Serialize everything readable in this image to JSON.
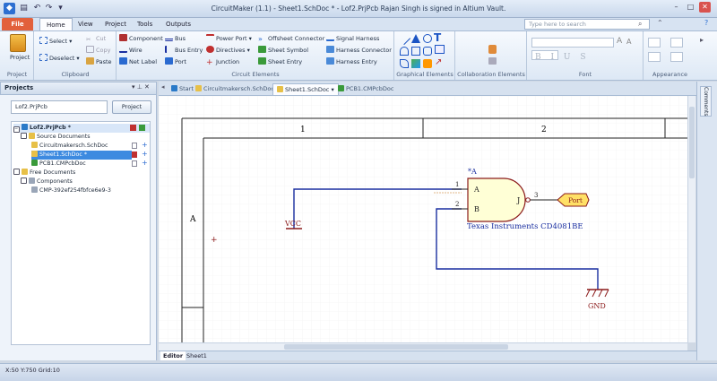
{
  "window": {
    "title": "CircuitMaker (1.1) - Sheet1.SchDoc * - Lof2.PrjPcb Rajan Singh is signed in Altium Vault.",
    "min": "–",
    "max": "□",
    "close": "✕"
  },
  "ribbon_tabs": [
    "File",
    "Home",
    "View",
    "Project",
    "Tools",
    "Outputs"
  ],
  "search": {
    "placeholder": "Type here to search"
  },
  "ribbon": {
    "project": {
      "label": "Project",
      "group": "Project"
    },
    "clipboard": {
      "select": "Select",
      "deselect": "Deselect",
      "cut": "Cut",
      "copy": "Copy",
      "paste": "Paste",
      "group": "Clipboard"
    },
    "circuit": {
      "component": "Component",
      "wire": "Wire",
      "net_label": "Net Label",
      "bus": "Bus",
      "bus_entry": "Bus Entry",
      "port": "Port",
      "power_port": "Power Port",
      "directives": "Directives",
      "junction": "Junction",
      "offsheet": "Offsheet Connector",
      "sheet_symbol": "Sheet Symbol",
      "sheet_entry": "Sheet Entry",
      "signal_harness": "Signal Harness",
      "harness_connector": "Harness Connector",
      "harness_entry": "Harness Entry",
      "group": "Circuit Elements"
    },
    "graphical": {
      "group": "Graphical Elements"
    },
    "collab": {
      "group": "Collaboration Elements"
    },
    "font": {
      "group": "Font",
      "styles": "B I U S"
    },
    "appearance": {
      "group": "Appearance"
    }
  },
  "left_panel": {
    "title": "Projects",
    "project_field": "Lof2.PrjPcb",
    "project_button": "Project",
    "tree": [
      "Lof2.PrjPcb *",
      "Source Documents",
      "Circuitmakersch.SchDoc",
      "Sheet1.SchDoc *",
      "PCB1.CMPcbDoc",
      "Free Documents",
      "Components",
      "CMP-392ef254fbfce6e9-3"
    ]
  },
  "doc_tabs": [
    "Start",
    "Circuitmakersch.SchDoc",
    "Sheet1.SchDoc",
    "PCB1.CMPcbDoc"
  ],
  "right_panel": {
    "comments": "Comments"
  },
  "schematic": {
    "col1": "1",
    "col2": "2",
    "row_a": "A",
    "designator": "*A",
    "pin_a": "A",
    "pin_b": "B",
    "pin_j": "J",
    "pin1": "1",
    "pin2": "2",
    "pin3": "3",
    "port": "Port",
    "part": "Texas Instruments CD4081BE",
    "vcc": "VCC",
    "gnd": "GND"
  },
  "editor_tabs": [
    "Editor",
    "Sheet1"
  ],
  "status": "X:50 Y:750   Grid:10",
  "colors": {
    "file_tab": "#e2603b",
    "wire": "#1a2fa0",
    "power": "#8b1a1a",
    "part_fill": "#ffffd6",
    "port_fill": "#ffe066"
  }
}
